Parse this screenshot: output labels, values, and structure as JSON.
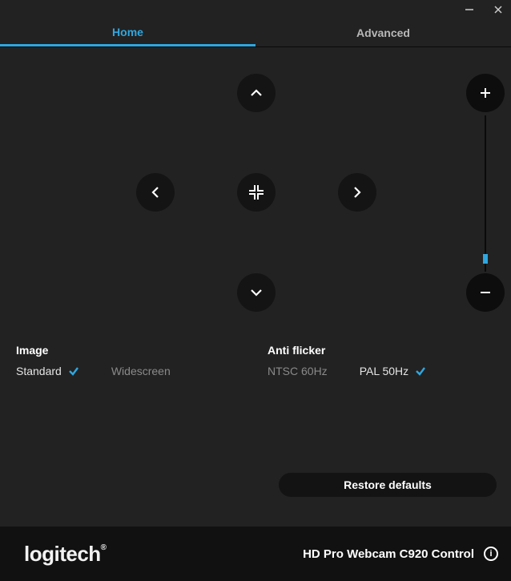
{
  "tabs": {
    "home": "Home",
    "advanced": "Advanced"
  },
  "image": {
    "label": "Image",
    "standard": "Standard",
    "widescreen": "Widescreen"
  },
  "antiflicker": {
    "label": "Anti flicker",
    "ntsc": "NTSC 60Hz",
    "pal": "PAL 50Hz"
  },
  "restore": "Restore defaults",
  "footer": {
    "brand": "logitech",
    "product": "HD Pro Webcam C920 Control"
  }
}
